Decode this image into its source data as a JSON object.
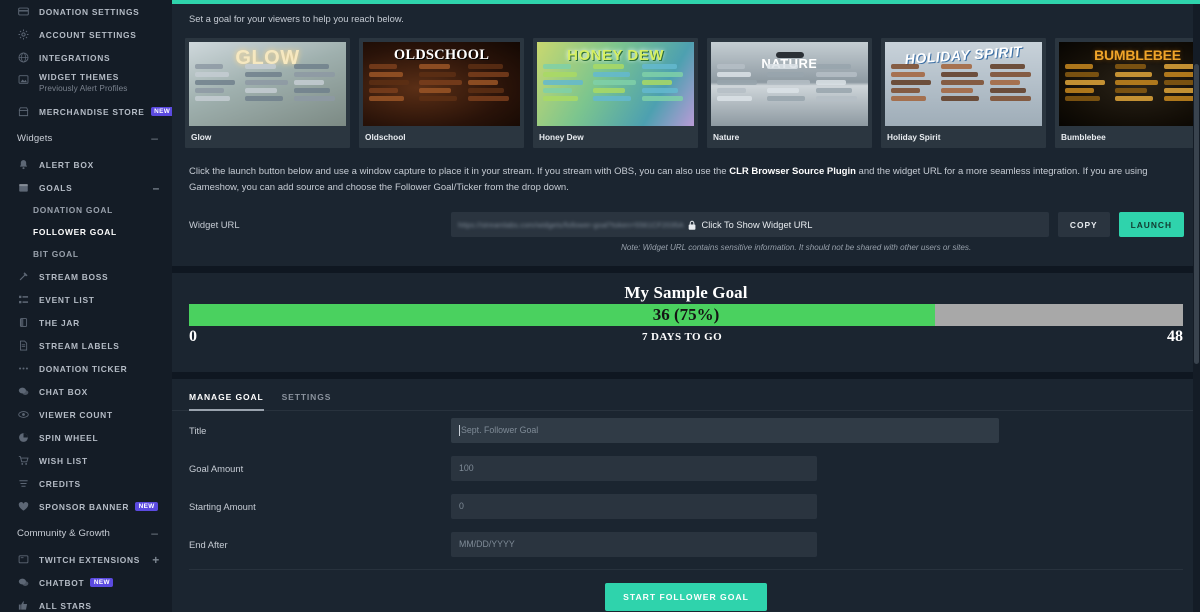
{
  "theme": {
    "accent": "#2fd3ac",
    "badge": "#5b4ae0",
    "panel_bg": "#1b2530",
    "page_bg": "#0f1721",
    "sidebar_bg": "#141c26",
    "goal_fill": "#4ad15f",
    "goal_track": "#a8a8a8"
  },
  "sidebar": {
    "top_items": [
      {
        "label": "DONATION SETTINGS",
        "icon": "card-icon",
        "badge": ""
      },
      {
        "label": "ACCOUNT SETTINGS",
        "icon": "gear-icon",
        "badge": ""
      },
      {
        "label": "INTEGRATIONS",
        "icon": "globe-icon",
        "badge": ""
      },
      {
        "label": "WIDGET THEMES",
        "sub": "Previously Alert Profiles",
        "icon": "image-icon",
        "badge": ""
      },
      {
        "label": "MERCHANDISE STORE",
        "icon": "store-icon",
        "badge": "NEW"
      }
    ],
    "widgets_section": {
      "title": "Widgets",
      "sign": "–"
    },
    "widget_items": [
      {
        "label": "ALERT BOX",
        "icon": "bell-icon",
        "badge": ""
      },
      {
        "label": "GOALS",
        "icon": "calendar-icon",
        "badge": "",
        "sign": "–"
      }
    ],
    "goal_subitems": [
      {
        "label": "DONATION GOAL",
        "active": false
      },
      {
        "label": "FOLLOWER GOAL",
        "active": true
      },
      {
        "label": "BIT GOAL",
        "active": false
      }
    ],
    "widget_items_rest": [
      {
        "label": "STREAM BOSS",
        "icon": "axe-icon",
        "badge": ""
      },
      {
        "label": "EVENT LIST",
        "icon": "list-icon",
        "badge": ""
      },
      {
        "label": "THE JAR",
        "icon": "jar-icon",
        "badge": ""
      },
      {
        "label": "STREAM LABELS",
        "icon": "file-icon",
        "badge": ""
      },
      {
        "label": "DONATION TICKER",
        "icon": "dots-icon",
        "badge": ""
      },
      {
        "label": "CHAT BOX",
        "icon": "chat-icon",
        "badge": ""
      },
      {
        "label": "VIEWER COUNT",
        "icon": "eye-icon",
        "badge": ""
      },
      {
        "label": "SPIN WHEEL",
        "icon": "pie-icon",
        "badge": ""
      },
      {
        "label": "WISH LIST",
        "icon": "cart-icon",
        "badge": ""
      },
      {
        "label": "CREDITS",
        "icon": "lines-icon",
        "badge": ""
      },
      {
        "label": "SPONSOR BANNER",
        "icon": "heart-icon",
        "badge": "NEW"
      }
    ],
    "community_section": {
      "title": "Community & Growth",
      "sign": "–"
    },
    "community_items": [
      {
        "label": "TWITCH EXTENSIONS",
        "icon": "window-icon",
        "badge": "",
        "sign": "+"
      },
      {
        "label": "CHATBOT",
        "icon": "chat-icon",
        "badge": "NEW"
      },
      {
        "label": "ALL STARS",
        "icon": "thumbsup-icon",
        "badge": ""
      }
    ]
  },
  "main": {
    "intro": "Set a goal for your viewers to help you reach below.",
    "themes": [
      {
        "name": "Glow",
        "art_title": "GLOW"
      },
      {
        "name": "Oldschool",
        "art_title": "OLDSCHOOL"
      },
      {
        "name": "Honey Dew",
        "art_title": "HONEY DEW"
      },
      {
        "name": "Nature",
        "art_title": "NATURE"
      },
      {
        "name": "Holiday Spirit",
        "art_title": "HOLIDAY SPIRIT"
      },
      {
        "name": "Bumblebee",
        "art_title": "BUMBLEBEE"
      }
    ],
    "instructions_part1": "Click the launch button below and use a window capture to place it in your stream. If you stream with OBS, you can also use the ",
    "instructions_link": "CLR Browser Source Plugin",
    "instructions_part2": " and the widget URL for a more seamless integration. If you are using Gameshow, you can add source and choose the Follower Goal/Ticker from the drop down.",
    "widget_url": {
      "label": "Widget URL",
      "masked_value": "https://streamlabs.com/widgets/follower-goal?token=5561CF2035A",
      "overlay_text": "Click To Show Widget URL",
      "lock_icon": "lock-icon",
      "copy_label": "COPY",
      "launch_label": "LAUNCH",
      "note": "Note: Widget URL contains sensitive information. It should not be shared with other users or sites."
    },
    "goal_preview": {
      "title": "My Sample Goal",
      "value_text": "36 (75%)",
      "percent": 75,
      "min_label": "0",
      "max_label": "48",
      "time_label": "7 DAYS TO GO"
    },
    "tabs": [
      {
        "label": "MANAGE GOAL",
        "active": true
      },
      {
        "label": "SETTINGS",
        "active": false
      }
    ],
    "form": {
      "fields": [
        {
          "label": "Title",
          "placeholder": "Sept. Follower Goal",
          "value": "",
          "wide": true,
          "caret": true
        },
        {
          "label": "Goal Amount",
          "placeholder": "100",
          "value": "",
          "wide": false,
          "caret": false
        },
        {
          "label": "Starting Amount",
          "placeholder": "0",
          "value": "",
          "wide": false,
          "caret": false
        },
        {
          "label": "End After",
          "placeholder": "MM/DD/YYYY",
          "value": "",
          "wide": false,
          "caret": false
        }
      ],
      "submit_label": "START FOLLOWER GOAL"
    }
  }
}
